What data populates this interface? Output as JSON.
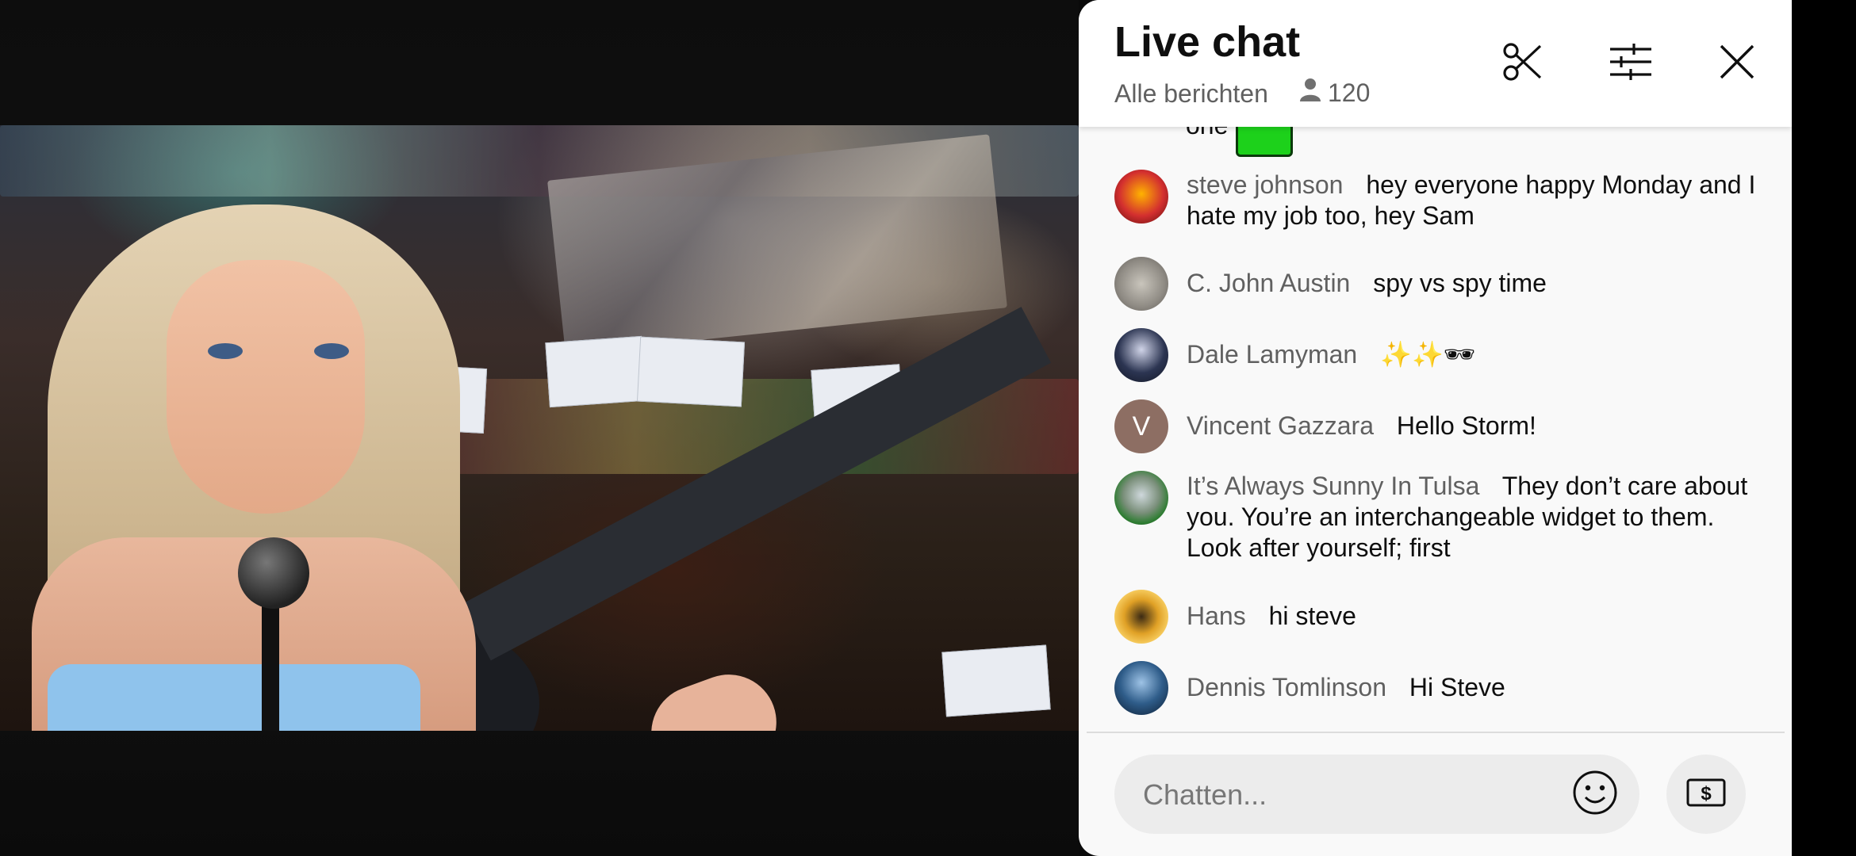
{
  "chat": {
    "title": "Live chat",
    "subtitle": "Alle berichten",
    "viewer_count": "120",
    "header_icons": [
      "scissors-icon",
      "filter-sliders-icon",
      "close-icon"
    ],
    "partial_message_text": "one",
    "messages": [
      {
        "author": "steve johnson",
        "text": "hey everyone happy Monday and I hate my job too, hey Sam"
      },
      {
        "author": "C. John Austin",
        "text": "spy vs spy time"
      },
      {
        "author": "Dale Lamyman",
        "text": "✨✨🕶"
      },
      {
        "author": "Vincent Gazzara",
        "text": "Hello Storm!",
        "avatar_letter": "V",
        "avatar_color": "#8d6e63"
      },
      {
        "author": "It’s Always Sunny In Tulsa",
        "text": "They don’t care about you. You’re an interchangeable widget to them. Look after yourself; first"
      },
      {
        "author": "Hans",
        "text": "hi steve"
      },
      {
        "author": "Dennis Tomlinson",
        "text": "Hi Steve"
      }
    ],
    "input_placeholder": "Chatten...",
    "input_icons": [
      "emoji-icon",
      "super-chat-dollar-icon"
    ]
  },
  "colors": {
    "panel_bg": "#f9f9f9",
    "header_bg": "#ffffff",
    "author_text": "#606060",
    "message_text": "#0f0f0f",
    "input_bg": "#ececec"
  }
}
